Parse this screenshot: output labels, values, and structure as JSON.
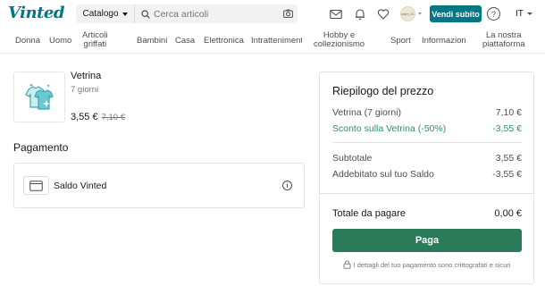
{
  "header": {
    "logo": "Vinted",
    "catalog_label": "Catalogo",
    "search_placeholder": "Cerca articoli",
    "avatar_text": "user_01",
    "sell_label": "Vendi subito",
    "help_label": "?",
    "lang_label": "IT"
  },
  "nav": {
    "items": [
      {
        "label": "Donna"
      },
      {
        "label": "Uomo"
      },
      {
        "label": "Articoli\ngriffati"
      },
      {
        "label": "Bambini"
      },
      {
        "label": "Casa"
      },
      {
        "label": "Elettronica"
      },
      {
        "label": "Intrattenimento"
      },
      {
        "label": "Hobby e\ncollezionismo"
      },
      {
        "label": "Sport"
      },
      {
        "label": "Informazion"
      },
      {
        "label": "La nostra\npiattaforma"
      }
    ]
  },
  "item": {
    "title": "Vetrina",
    "subtitle": "7 giorni",
    "price": "3,55 €",
    "old_price": "7,10 €"
  },
  "payment": {
    "section_title": "Pagamento",
    "method": "Saldo Vinted",
    "info_icon": "i"
  },
  "summary": {
    "title": "Riepilogo del prezzo",
    "rows": [
      {
        "label": "Vetrina (7 giorni)",
        "value": "7,10 €"
      },
      {
        "label": "Sconto sulla Vetrina (-50%)",
        "value": "-3,55 €"
      },
      {
        "label": "Subtotale",
        "value": "3,55 €"
      },
      {
        "label": "Addebitato sul tuo Saldo",
        "value": "-3,55 €"
      }
    ],
    "total_label": "Totale da pagare",
    "total_value": "0,00 €",
    "pay_label": "Paga",
    "secure_note": "I dettagli del tuo pagamento sono crittografati e sicuri"
  },
  "colors": {
    "brand": "#007782",
    "pay_button": "#2b7a5a",
    "discount": "#2d8f6f"
  }
}
